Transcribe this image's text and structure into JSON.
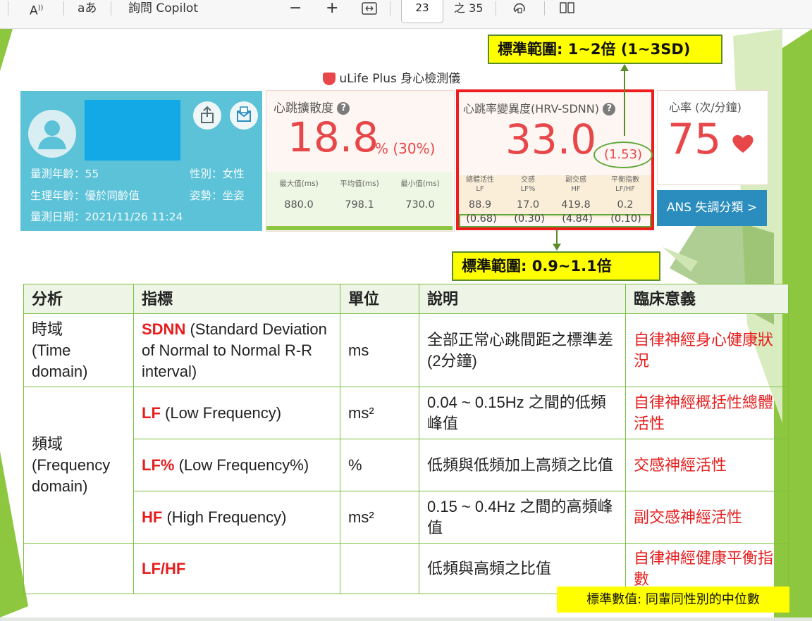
{
  "toolbar": {
    "read_aloud_icon": "read-aloud-icon",
    "translate_icon": "translate-icon",
    "ask_copilot": "詢問 Copilot",
    "zoom_out": "−",
    "zoom_in": "+",
    "fit_icon": "fit-width-icon",
    "page_current": "23",
    "page_total": "之 35",
    "rotate_icon": "rotate-icon",
    "view_icon": "page-view-icon"
  },
  "device": {
    "title": "uLife Plus 身心檢測儀",
    "profile": {
      "measured_age": "量測年齡：55",
      "gender": "性別：女性",
      "physio_age": "生理年齡：優於同齡值",
      "posture": "姿勢：坐姿",
      "date": "量測日期：2021/11/26 11:24"
    },
    "dispersion": {
      "title": "心跳擴散度",
      "value": "18.8",
      "unit": "% (30%)",
      "labels": [
        "最大值(ms)",
        "平均值(ms)",
        "最小值(ms)"
      ],
      "values": [
        "880.0",
        "798.1",
        "730.0"
      ]
    },
    "hrv": {
      "title": "心跳率變異度(HRV-SDNN)",
      "value": "33.0",
      "ratio": "(1.53)",
      "labels": [
        [
          "總體活性",
          "LF"
        ],
        [
          "交感",
          "LF%"
        ],
        [
          "副交感",
          "HF"
        ],
        [
          "平衡指數",
          "LF/HF"
        ]
      ],
      "values": [
        "88.9",
        "17.0",
        "419.8",
        "0.2"
      ],
      "ratios": [
        "(0.68)",
        "(0.30)",
        "(4.84)",
        "(0.10)"
      ]
    },
    "heart_rate": {
      "title": "心率 (次/分鐘)",
      "value": "75",
      "ans_button": "ANS 失調分類 >"
    }
  },
  "callouts": {
    "top": "標準範圍: 1~2倍 (1~3SD)",
    "middle": "標準範圍: 0.9~1.1倍",
    "bottom_note": "標準數值: 同輩同性別的中位數"
  },
  "table": {
    "headers": [
      "分析",
      "指標",
      "單位",
      "說明",
      "臨床意義"
    ],
    "rows": [
      {
        "group": "時域\n(Time\ndomain)",
        "kw": "SDNN",
        "rest": " (Standard Deviation of Normal to Normal R-R interval)",
        "unit": "ms",
        "desc": "全部正常心跳間距之標準差(2分鐘)",
        "meaning": "自律神經身心健康狀況"
      },
      {
        "group": "頻域\n(Frequency\ndomain)",
        "kw": "LF",
        "rest": " (Low Frequency)",
        "unit": "ms²",
        "desc": "0.04 ~ 0.15Hz 之間的低頻峰值",
        "meaning": "自律神經概括性總體活性"
      },
      {
        "group": "",
        "kw": "LF%",
        "rest": " (Low Frequency%)",
        "unit": "%",
        "desc": "低頻與低頻加上高頻之比值",
        "meaning": "交感神經活性"
      },
      {
        "group": "",
        "kw": "HF",
        "rest": " (High Frequency)",
        "unit": "ms²",
        "desc": "0.15 ~ 0.4Hz 之間的高頻峰值",
        "meaning": "副交感神經活性"
      },
      {
        "group": "",
        "kw": "LF/HF",
        "rest": "",
        "unit": "",
        "desc": "低頻與高頻之比值",
        "meaning": "自律神經健康平衡指數"
      }
    ]
  },
  "colors": {
    "accent_green": "#7cc040",
    "callout_yellow": "#ffff00",
    "metric_red": "#e8474a",
    "highlight_red": "#e61d1d",
    "profile_blue": "#5bc2d8"
  }
}
